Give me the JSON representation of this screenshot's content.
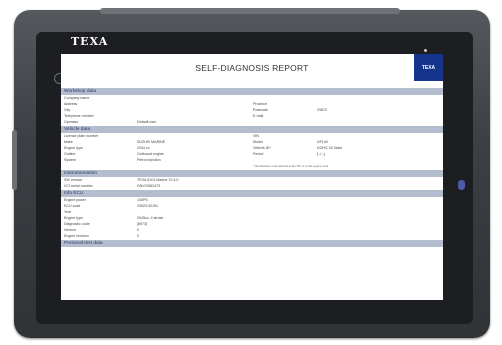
{
  "device": {
    "brand": "TEXA"
  },
  "report": {
    "title": "SELF-DIAGNOSIS REPORT",
    "logo_text": "TEXA",
    "sections": [
      {
        "title": "Workshop data",
        "rows": [
          {
            "l1": "Company name",
            "v1": "",
            "l2": "",
            "v2": ""
          },
          {
            "l1": "Address",
            "v1": "",
            "l2": "Province",
            "v2": ""
          },
          {
            "l1": "City",
            "v1": "",
            "l2": "Postcode",
            "v2": "29872"
          },
          {
            "l1": "Telephone number",
            "v1": "",
            "l2": "E-mail",
            "v2": ""
          },
          {
            "l1": "Operator",
            "v1": "Default user",
            "l2": "",
            "v2": ""
          }
        ]
      },
      {
        "title": "Vehicle data",
        "rows": [
          {
            "l1": "License plate number",
            "v1": "",
            "l2": "VIN",
            "v2": ""
          },
          {
            "l1": "Make",
            "v1": "SUZUKI MARINE",
            "l2": "Model",
            "v2": "DF140"
          },
          {
            "l1": "Engine type",
            "v1": "2044 cc",
            "l2": "Vehicle-ID*",
            "v2": "DOHC 16 Valve"
          },
          {
            "l1": "Outline",
            "v1": "Outboard engine",
            "l2": "Period",
            "v2": "[--/--]"
          },
          {
            "l1": "System",
            "v1": "Petrol injection",
            "l2": "",
            "v2": ""
          }
        ],
        "note": "* Identification code referred to the VIN or to the engine code"
      },
      {
        "title": "Instrumentation",
        "rows": [
          {
            "l1": "SW version",
            "v1": "TEXA IDC5 Marine 70.4.0",
            "l2": "",
            "v2": ""
          },
          {
            "l1": "VCI serial number",
            "v1": "DNVCI582473",
            "l2": "",
            "v2": ""
          }
        ]
      },
      {
        "title": "Info ECU",
        "rows": [
          {
            "l1": "Engine power",
            "v1": "140PS",
            "l2": "",
            "v2": ""
          },
          {
            "l1": "ECU code",
            "v1": "33920-92J91",
            "l2": "",
            "v2": ""
          },
          {
            "l1": "Year",
            "v1": "",
            "l2": "",
            "v2": ""
          },
          {
            "l1": "Engine type",
            "v1": "2045cc, 4 stroke",
            "l2": "",
            "v2": ""
          },
          {
            "l1": "Diagnostic code",
            "v1": "[8973]",
            "l2": "",
            "v2": ""
          },
          {
            "l1": "Version",
            "v1": "0",
            "l2": "",
            "v2": ""
          },
          {
            "l1": "Engine revision",
            "v1": "0",
            "l2": "",
            "v2": ""
          }
        ]
      },
      {
        "title": "Personal test data",
        "rows": []
      }
    ]
  }
}
